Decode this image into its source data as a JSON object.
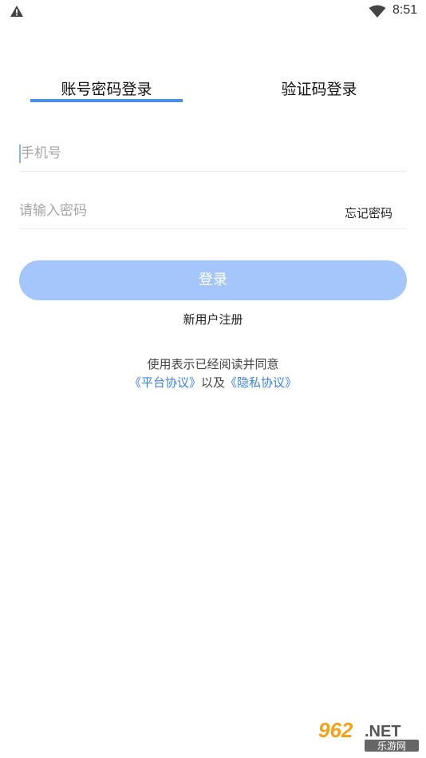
{
  "status_bar": {
    "time": "8:51",
    "icons": [
      "warning-icon",
      "wifi-icon"
    ]
  },
  "tabs": [
    {
      "label": "账号密码登录",
      "active": true
    },
    {
      "label": "验证码登录",
      "active": false
    }
  ],
  "form": {
    "phone_placeholder": "手机号",
    "password_placeholder": "请输入密码",
    "forgot_label": "忘记密码"
  },
  "login_button": {
    "label": "登录"
  },
  "register_label": "新用户注册",
  "agreement": {
    "line1": "使用表示已经阅读并同意",
    "platform_link": "《平台协议》",
    "connector": "以及",
    "privacy_link": "《隐私协议》"
  },
  "watermark": {
    "brand": "962.NET",
    "sub": "乐游网"
  },
  "colors": {
    "accent": "#4a8ee6",
    "button": "#a4c6fb",
    "link": "#3f82e4"
  }
}
